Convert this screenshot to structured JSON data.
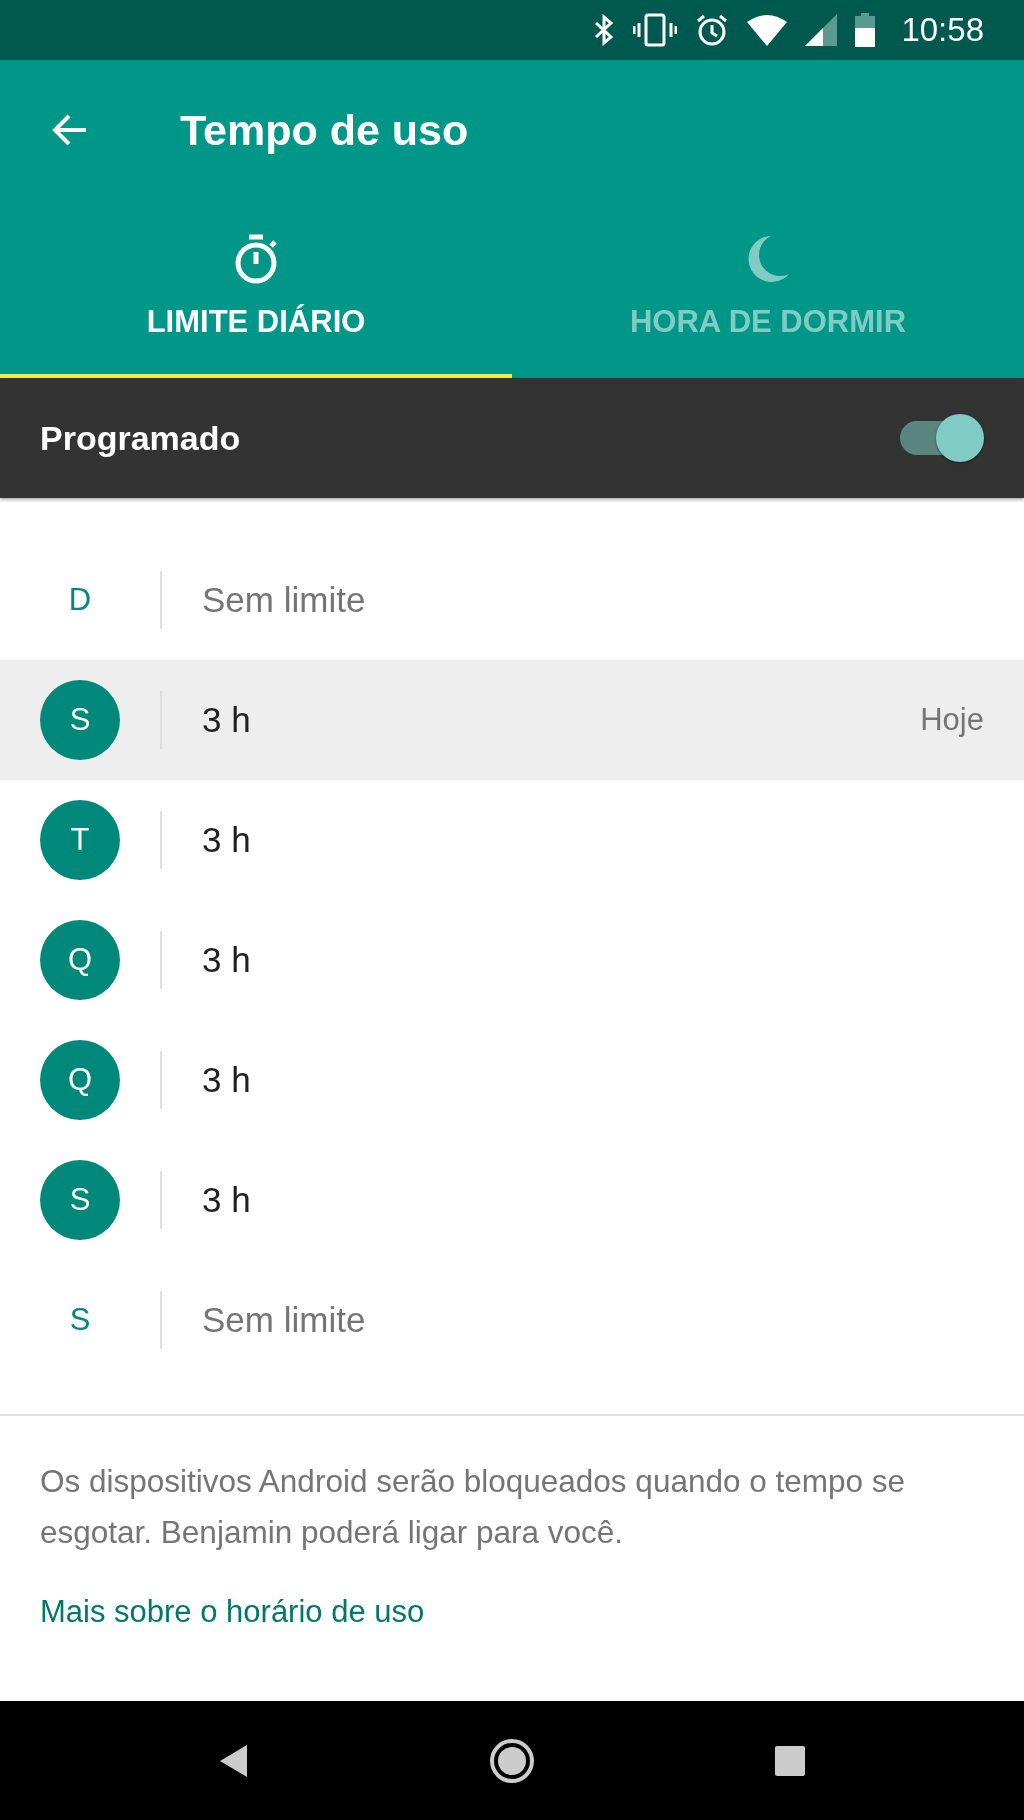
{
  "status_bar": {
    "time": "10:58"
  },
  "app_bar": {
    "title": "Tempo de uso"
  },
  "tabs": [
    {
      "label": "LIMITE DIÁRIO",
      "selected": true
    },
    {
      "label": "HORA DE DORMIR",
      "selected": false
    }
  ],
  "schedule": {
    "label": "Programado",
    "on": true
  },
  "days": [
    {
      "letter": "D",
      "limit": "Sem limite",
      "has_limit": false,
      "selected": false
    },
    {
      "letter": "S",
      "limit": "3 h",
      "has_limit": true,
      "selected": true,
      "note": "Hoje"
    },
    {
      "letter": "T",
      "limit": "3 h",
      "has_limit": true,
      "selected": false
    },
    {
      "letter": "Q",
      "limit": "3 h",
      "has_limit": true,
      "selected": false
    },
    {
      "letter": "Q",
      "limit": "3 h",
      "has_limit": true,
      "selected": false
    },
    {
      "letter": "S",
      "limit": "3 h",
      "has_limit": true,
      "selected": false
    },
    {
      "letter": "S",
      "limit": "Sem limite",
      "has_limit": false,
      "selected": false
    }
  ],
  "footer": {
    "text": "Os dispositivos Android serão bloqueados quando o tempo se esgotar. Benjamin poderá ligar para você.",
    "link": "Mais sobre o horário de uso"
  }
}
